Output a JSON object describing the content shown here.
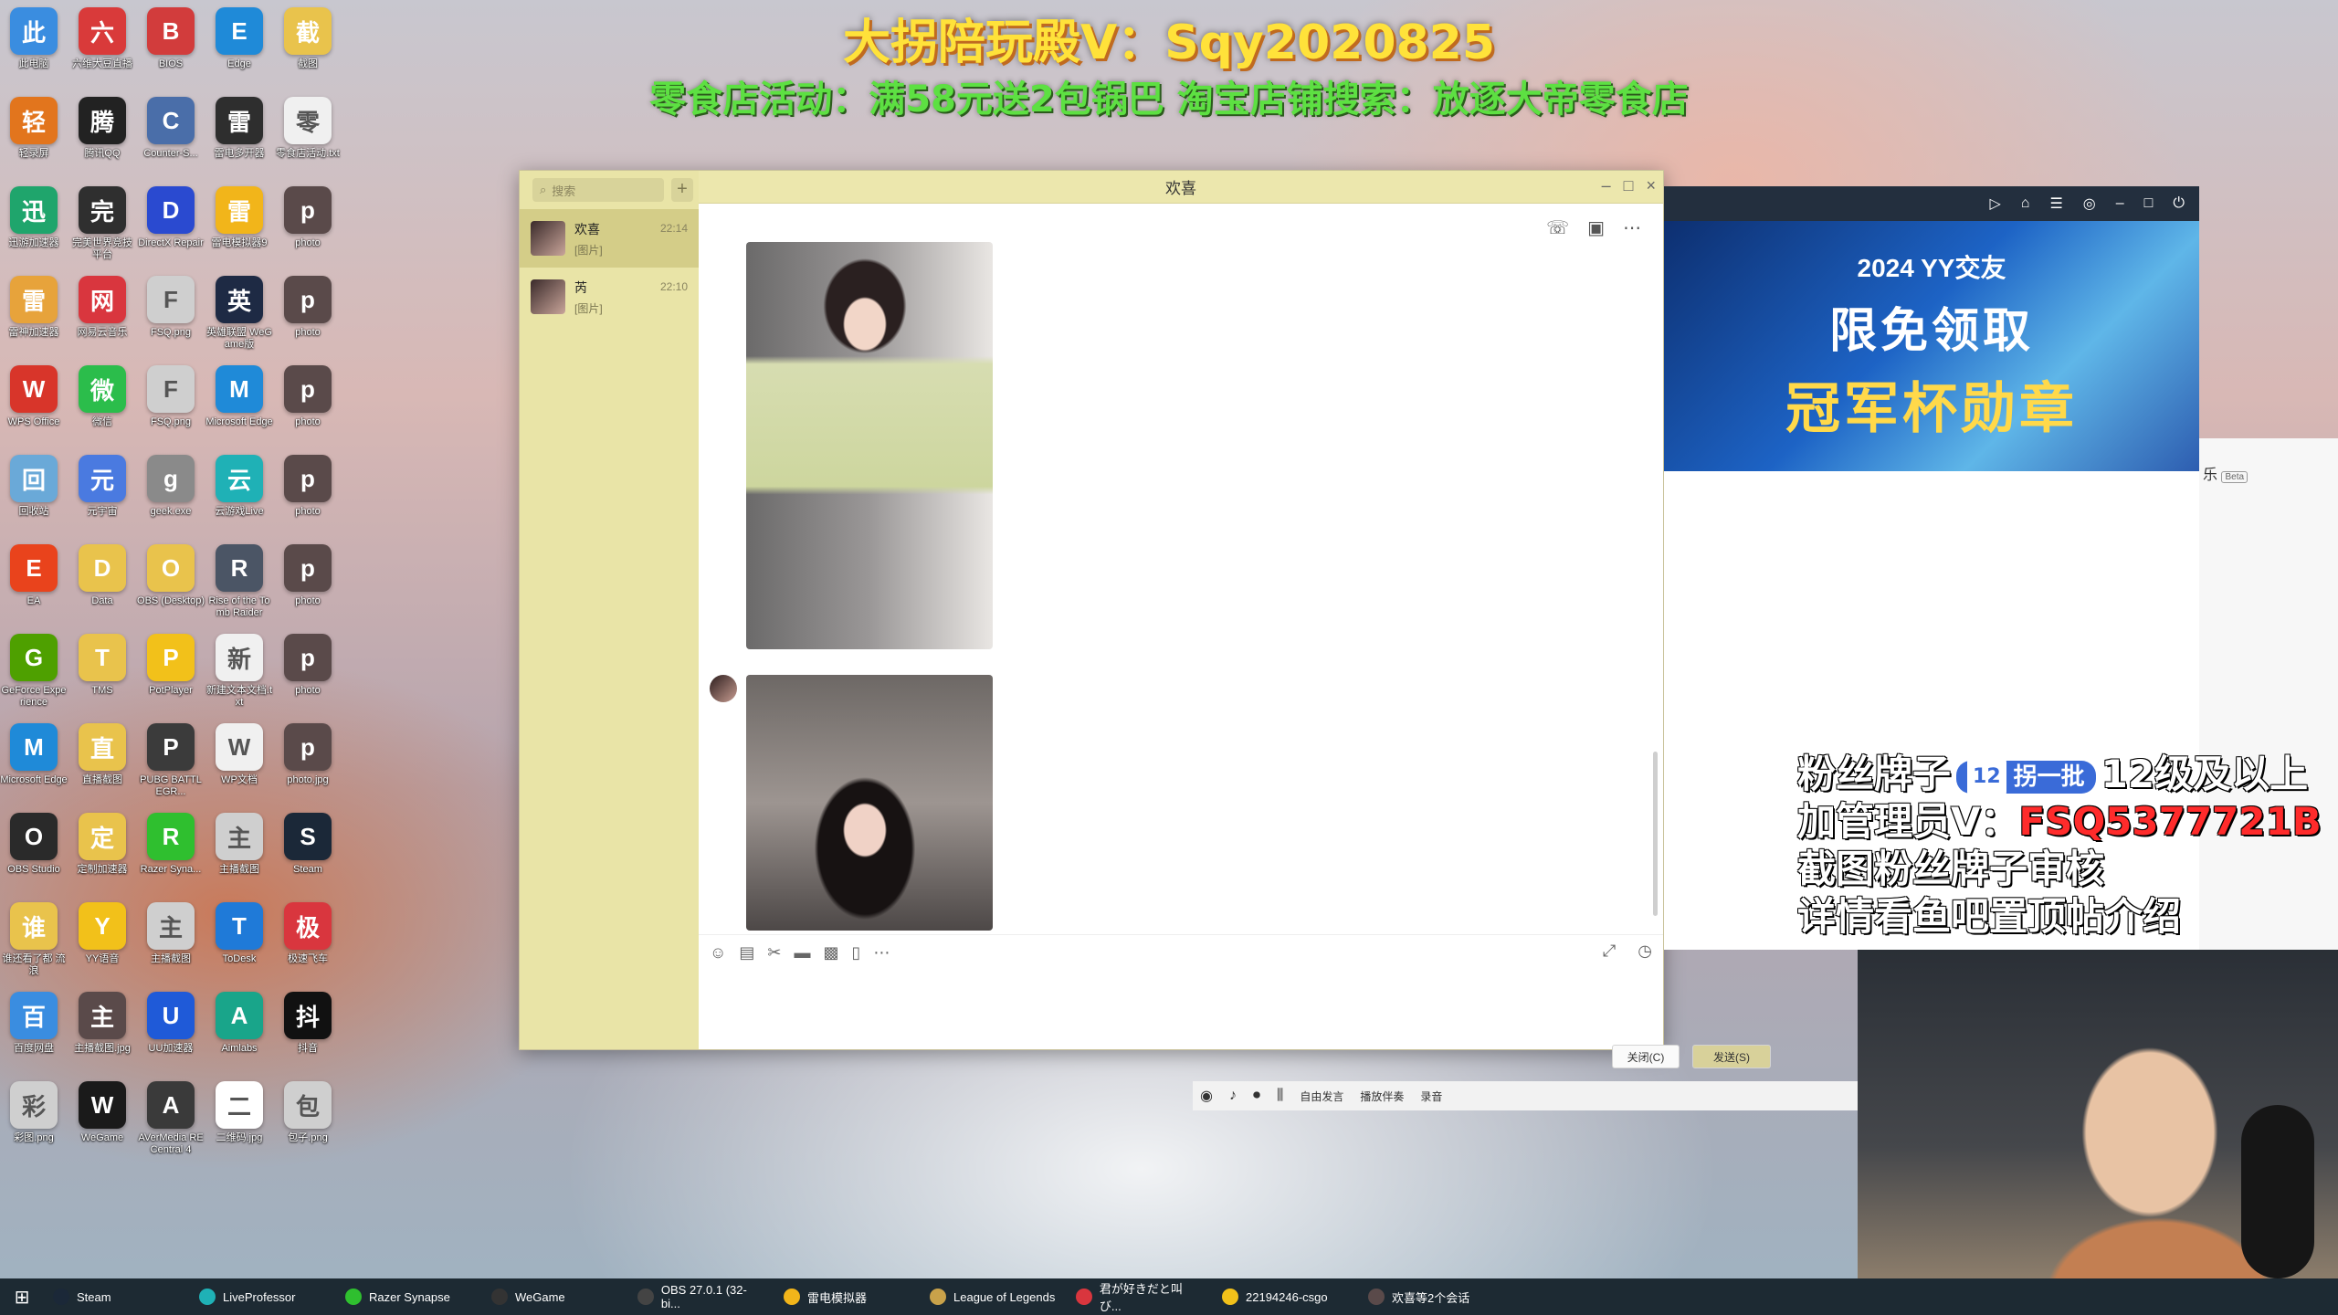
{
  "overlay": {
    "line1": "大拐陪玩殿V：Sqy2020825",
    "line2": "零食店活动：满58元送2包锅巴 淘宝店铺搜索：放逐大帝零食店"
  },
  "desktop_icons": [
    {
      "label": "此电脑",
      "icon": "computer-icon",
      "color": "#3a8de0"
    },
    {
      "label": "六维大豆直播",
      "icon": "app-icon",
      "color": "#d93a3a"
    },
    {
      "label": "BIOS",
      "icon": "power-icon",
      "color": "#d23c3c"
    },
    {
      "label": "Edge",
      "icon": "edge-icon",
      "color": "#1f8ad8"
    },
    {
      "label": "截图",
      "icon": "folder-icon",
      "color": "#e9c34c"
    },
    {
      "label": "轻录屏",
      "icon": "record-icon",
      "color": "#e2751d"
    },
    {
      "label": "腾讯QQ",
      "icon": "qq-icon",
      "color": "#222222"
    },
    {
      "label": "Counter-S...",
      "icon": "game-icon",
      "color": "#4a6ea9"
    },
    {
      "label": "雷电多开器",
      "icon": "lightning-icon",
      "color": "#2e2e2e"
    },
    {
      "label": "零食店活动.txt",
      "icon": "text-file-icon",
      "color": "#f0f0f0"
    },
    {
      "label": "迅游加速器",
      "icon": "accelerator-icon",
      "color": "#1fa56c"
    },
    {
      "label": "完美世界竞技平台",
      "icon": "game-icon",
      "color": "#2f2f2f"
    },
    {
      "label": "DirectX Repair",
      "icon": "repair-icon",
      "color": "#2a4ad0"
    },
    {
      "label": "雷电模拟器9",
      "icon": "emulator-icon",
      "color": "#f2b51a"
    },
    {
      "label": "photo",
      "icon": "image-icon",
      "color": "#5a4a4a"
    },
    {
      "label": "雷神加速器",
      "icon": "accelerator-icon",
      "color": "#e7a33b"
    },
    {
      "label": "网易云音乐",
      "icon": "music-icon",
      "color": "#d9363e"
    },
    {
      "label": "FSQ.png",
      "icon": "image-icon",
      "color": "#cfcfcf"
    },
    {
      "label": "英雄联盟 WeGame版",
      "icon": "game-icon",
      "color": "#1e2a44"
    },
    {
      "label": "photo",
      "icon": "image-icon",
      "color": "#5a4a4a"
    },
    {
      "label": "WPS Office",
      "icon": "wps-icon",
      "color": "#d8352a"
    },
    {
      "label": "微信",
      "icon": "wechat-icon",
      "color": "#2bbd4b"
    },
    {
      "label": "FSQ.png",
      "icon": "image-icon",
      "color": "#cfcfcf"
    },
    {
      "label": "Microsoft Edge",
      "icon": "edge-icon",
      "color": "#1f8ad8"
    },
    {
      "label": "photo",
      "icon": "image-icon",
      "color": "#5a4a4a"
    },
    {
      "label": "回收站",
      "icon": "recycle-bin-icon",
      "color": "#6aa9d8"
    },
    {
      "label": "元宇宙",
      "icon": "app-icon",
      "color": "#4a7ae0"
    },
    {
      "label": "geek.exe",
      "icon": "app-icon",
      "color": "#8a8a8a"
    },
    {
      "label": "云游戏Live",
      "icon": "cloud-icon",
      "color": "#1fb1b6"
    },
    {
      "label": "photo",
      "icon": "image-icon",
      "color": "#5a4a4a"
    },
    {
      "label": "EA",
      "icon": "ea-icon",
      "color": "#e9431c"
    },
    {
      "label": "Data",
      "icon": "folder-icon",
      "color": "#e9c34c"
    },
    {
      "label": "OBS (Desktop)",
      "icon": "folder-icon",
      "color": "#e9c34c"
    },
    {
      "label": "Rise of the Tomb Raider",
      "icon": "game-icon",
      "color": "#4b5565"
    },
    {
      "label": "photo",
      "icon": "image-icon",
      "color": "#5a4a4a"
    },
    {
      "label": "GeForce Experience",
      "icon": "nvidia-icon",
      "color": "#4ea000"
    },
    {
      "label": "TMS",
      "icon": "folder-icon",
      "color": "#e9c34c"
    },
    {
      "label": "PotPlayer",
      "icon": "player-icon",
      "color": "#f2c11a"
    },
    {
      "label": "新建文本文档.txt",
      "icon": "text-file-icon",
      "color": "#f0f0f0"
    },
    {
      "label": "photo",
      "icon": "image-icon",
      "color": "#5a4a4a"
    },
    {
      "label": "Microsoft Edge",
      "icon": "edge-icon",
      "color": "#1f8ad8"
    },
    {
      "label": "直播截图",
      "icon": "folder-icon",
      "color": "#e9c34c"
    },
    {
      "label": "PUBG BATTLEGR...",
      "icon": "game-icon",
      "color": "#3b3b3b"
    },
    {
      "label": "WP文档",
      "icon": "text-file-icon",
      "color": "#f0f0f0"
    },
    {
      "label": "photo.jpg",
      "icon": "image-icon",
      "color": "#5a4a4a"
    },
    {
      "label": "OBS Studio",
      "icon": "obs-icon",
      "color": "#2a2a2a"
    },
    {
      "label": "定制加速器",
      "icon": "folder-icon",
      "color": "#e9c34c"
    },
    {
      "label": "Razer Syna...",
      "icon": "razer-icon",
      "color": "#2fbf2f"
    },
    {
      "label": "主播截图",
      "icon": "image-icon",
      "color": "#cfcfcf"
    },
    {
      "label": "Steam",
      "icon": "steam-icon",
      "color": "#1b2838"
    },
    {
      "label": "谁还看了都 流浪",
      "icon": "folder-icon",
      "color": "#e9c34c"
    },
    {
      "label": "YY语音",
      "icon": "yy-icon",
      "color": "#f2c11a"
    },
    {
      "label": "主播截图",
      "icon": "image-icon",
      "color": "#cfcfcf"
    },
    {
      "label": "ToDesk",
      "icon": "todesk-icon",
      "color": "#1f7ad8"
    },
    {
      "label": "极速飞车",
      "icon": "app-icon",
      "color": "#d9363e"
    },
    {
      "label": "百度网盘",
      "icon": "cloud-icon",
      "color": "#3a8de0"
    },
    {
      "label": "主播截图.jpg",
      "icon": "image-icon",
      "color": "#5a4a4a"
    },
    {
      "label": "UU加速器",
      "icon": "accelerator-icon",
      "color": "#1f5ad8"
    },
    {
      "label": "Aimlabs",
      "icon": "aimlabs-icon",
      "color": "#19a58a"
    },
    {
      "label": "抖音",
      "icon": "tiktok-icon",
      "color": "#111111"
    },
    {
      "label": "彩图.png",
      "icon": "image-icon",
      "color": "#cfcfcf"
    },
    {
      "label": "WeGame",
      "icon": "wegame-icon",
      "color": "#1a1a1a"
    },
    {
      "label": "AVerMedia RECentral 4",
      "icon": "app-icon",
      "color": "#3a3a3a"
    },
    {
      "label": "二维码.jpg",
      "icon": "qr-icon",
      "color": "#ffffff"
    },
    {
      "label": "包子.png",
      "icon": "image-icon",
      "color": "#cfcfcf"
    }
  ],
  "wechat": {
    "search_placeholder": "搜索",
    "title": "欢喜",
    "chats": [
      {
        "name": "欢喜",
        "preview": "[图片]",
        "time": "22:14"
      },
      {
        "name": "芮",
        "preview": "[图片]",
        "time": "22:10"
      }
    ],
    "close_btn": "关闭(C)",
    "send_btn": "发送(S)"
  },
  "yy": {
    "banner_line1": "2024 YY交友",
    "banner_line2": "限免领取",
    "banner_line3": "冠军杯勋章",
    "side_label": "乐",
    "beta": "Beta",
    "bottom": [
      "自由发言",
      "播放伴奏",
      "录音"
    ]
  },
  "fan_overlay": {
    "line1_pre": "粉丝牌子",
    "badge_level": "12",
    "badge_name": "拐一批",
    "line1_post": "12级及以上",
    "line2_pre": "加管理员V：",
    "line2_value": "FSQ5377721B",
    "line3": "截图粉丝牌子审核",
    "line4": "详情看鱼吧置顶帖介绍"
  },
  "taskbar": [
    {
      "label": "Steam",
      "color": "#1b2838"
    },
    {
      "label": "LiveProfessor",
      "color": "#1fb1b6"
    },
    {
      "label": "Razer Synapse",
      "color": "#2fbf2f"
    },
    {
      "label": "WeGame",
      "color": "#333333"
    },
    {
      "label": "OBS 27.0.1 (32-bi...",
      "color": "#444444"
    },
    {
      "label": "雷电模拟器",
      "color": "#f2b51a"
    },
    {
      "label": "League of Legends",
      "color": "#c9a24a"
    },
    {
      "label": "君が好きだと叫び...",
      "color": "#d9363e"
    },
    {
      "label": "22194246-csgo",
      "color": "#f2c11a"
    },
    {
      "label": "欢喜等2个会话",
      "color": "#5a4a4a"
    }
  ]
}
